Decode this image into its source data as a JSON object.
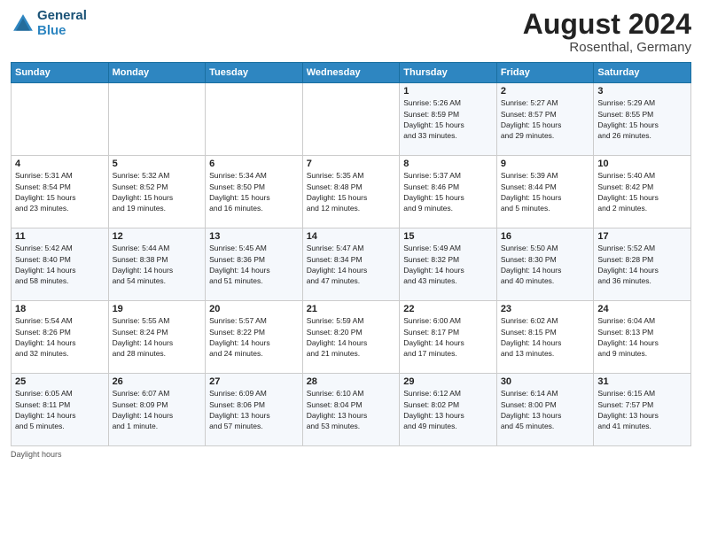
{
  "header": {
    "logo_line1": "General",
    "logo_line2": "Blue",
    "month": "August 2024",
    "location": "Rosenthal, Germany"
  },
  "weekdays": [
    "Sunday",
    "Monday",
    "Tuesday",
    "Wednesday",
    "Thursday",
    "Friday",
    "Saturday"
  ],
  "weeks": [
    [
      {
        "day": "",
        "info": ""
      },
      {
        "day": "",
        "info": ""
      },
      {
        "day": "",
        "info": ""
      },
      {
        "day": "",
        "info": ""
      },
      {
        "day": "1",
        "info": "Sunrise: 5:26 AM\nSunset: 8:59 PM\nDaylight: 15 hours\nand 33 minutes."
      },
      {
        "day": "2",
        "info": "Sunrise: 5:27 AM\nSunset: 8:57 PM\nDaylight: 15 hours\nand 29 minutes."
      },
      {
        "day": "3",
        "info": "Sunrise: 5:29 AM\nSunset: 8:55 PM\nDaylight: 15 hours\nand 26 minutes."
      }
    ],
    [
      {
        "day": "4",
        "info": "Sunrise: 5:31 AM\nSunset: 8:54 PM\nDaylight: 15 hours\nand 23 minutes."
      },
      {
        "day": "5",
        "info": "Sunrise: 5:32 AM\nSunset: 8:52 PM\nDaylight: 15 hours\nand 19 minutes."
      },
      {
        "day": "6",
        "info": "Sunrise: 5:34 AM\nSunset: 8:50 PM\nDaylight: 15 hours\nand 16 minutes."
      },
      {
        "day": "7",
        "info": "Sunrise: 5:35 AM\nSunset: 8:48 PM\nDaylight: 15 hours\nand 12 minutes."
      },
      {
        "day": "8",
        "info": "Sunrise: 5:37 AM\nSunset: 8:46 PM\nDaylight: 15 hours\nand 9 minutes."
      },
      {
        "day": "9",
        "info": "Sunrise: 5:39 AM\nSunset: 8:44 PM\nDaylight: 15 hours\nand 5 minutes."
      },
      {
        "day": "10",
        "info": "Sunrise: 5:40 AM\nSunset: 8:42 PM\nDaylight: 15 hours\nand 2 minutes."
      }
    ],
    [
      {
        "day": "11",
        "info": "Sunrise: 5:42 AM\nSunset: 8:40 PM\nDaylight: 14 hours\nand 58 minutes."
      },
      {
        "day": "12",
        "info": "Sunrise: 5:44 AM\nSunset: 8:38 PM\nDaylight: 14 hours\nand 54 minutes."
      },
      {
        "day": "13",
        "info": "Sunrise: 5:45 AM\nSunset: 8:36 PM\nDaylight: 14 hours\nand 51 minutes."
      },
      {
        "day": "14",
        "info": "Sunrise: 5:47 AM\nSunset: 8:34 PM\nDaylight: 14 hours\nand 47 minutes."
      },
      {
        "day": "15",
        "info": "Sunrise: 5:49 AM\nSunset: 8:32 PM\nDaylight: 14 hours\nand 43 minutes."
      },
      {
        "day": "16",
        "info": "Sunrise: 5:50 AM\nSunset: 8:30 PM\nDaylight: 14 hours\nand 40 minutes."
      },
      {
        "day": "17",
        "info": "Sunrise: 5:52 AM\nSunset: 8:28 PM\nDaylight: 14 hours\nand 36 minutes."
      }
    ],
    [
      {
        "day": "18",
        "info": "Sunrise: 5:54 AM\nSunset: 8:26 PM\nDaylight: 14 hours\nand 32 minutes."
      },
      {
        "day": "19",
        "info": "Sunrise: 5:55 AM\nSunset: 8:24 PM\nDaylight: 14 hours\nand 28 minutes."
      },
      {
        "day": "20",
        "info": "Sunrise: 5:57 AM\nSunset: 8:22 PM\nDaylight: 14 hours\nand 24 minutes."
      },
      {
        "day": "21",
        "info": "Sunrise: 5:59 AM\nSunset: 8:20 PM\nDaylight: 14 hours\nand 21 minutes."
      },
      {
        "day": "22",
        "info": "Sunrise: 6:00 AM\nSunset: 8:17 PM\nDaylight: 14 hours\nand 17 minutes."
      },
      {
        "day": "23",
        "info": "Sunrise: 6:02 AM\nSunset: 8:15 PM\nDaylight: 14 hours\nand 13 minutes."
      },
      {
        "day": "24",
        "info": "Sunrise: 6:04 AM\nSunset: 8:13 PM\nDaylight: 14 hours\nand 9 minutes."
      }
    ],
    [
      {
        "day": "25",
        "info": "Sunrise: 6:05 AM\nSunset: 8:11 PM\nDaylight: 14 hours\nand 5 minutes."
      },
      {
        "day": "26",
        "info": "Sunrise: 6:07 AM\nSunset: 8:09 PM\nDaylight: 14 hours\nand 1 minute."
      },
      {
        "day": "27",
        "info": "Sunrise: 6:09 AM\nSunset: 8:06 PM\nDaylight: 13 hours\nand 57 minutes."
      },
      {
        "day": "28",
        "info": "Sunrise: 6:10 AM\nSunset: 8:04 PM\nDaylight: 13 hours\nand 53 minutes."
      },
      {
        "day": "29",
        "info": "Sunrise: 6:12 AM\nSunset: 8:02 PM\nDaylight: 13 hours\nand 49 minutes."
      },
      {
        "day": "30",
        "info": "Sunrise: 6:14 AM\nSunset: 8:00 PM\nDaylight: 13 hours\nand 45 minutes."
      },
      {
        "day": "31",
        "info": "Sunrise: 6:15 AM\nSunset: 7:57 PM\nDaylight: 13 hours\nand 41 minutes."
      }
    ]
  ],
  "footer": {
    "daylight_label": "Daylight hours"
  }
}
